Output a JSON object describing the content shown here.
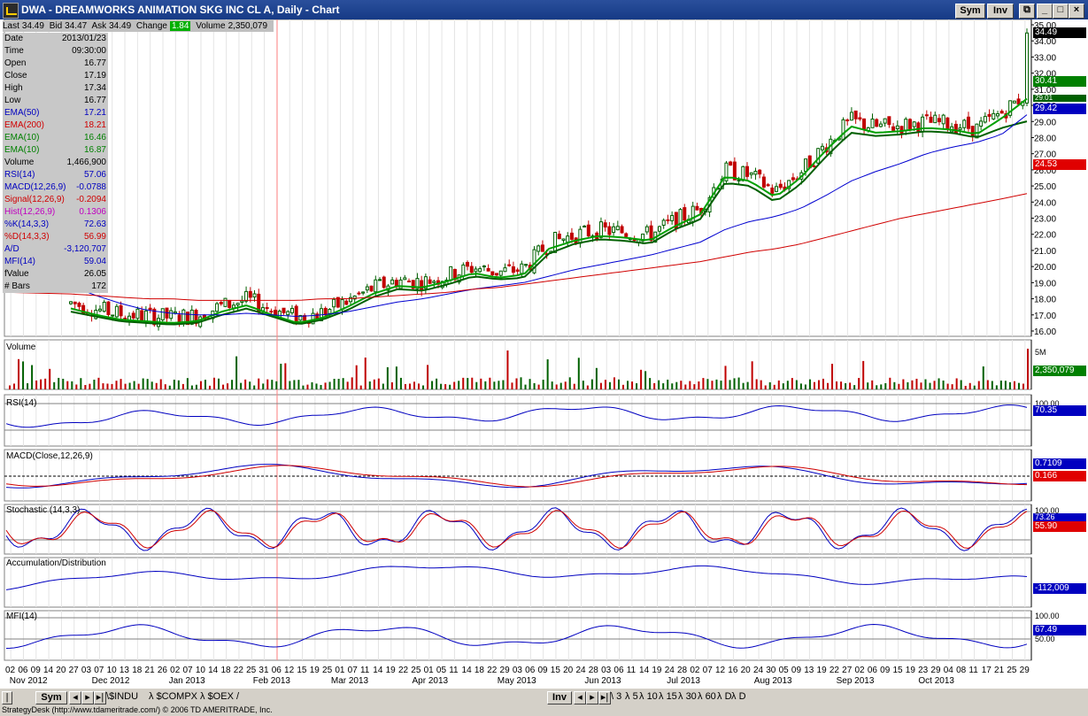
{
  "window": {
    "title": "DWA - DREAMWORKS ANIMATION SKG INC CL A, Daily - Chart",
    "sym_btn": "Sym",
    "inv_btn": "Inv",
    "restore_btn": "⧉",
    "minimize_btn": "_",
    "maximize_btn": "□",
    "close_btn": "×"
  },
  "quote": {
    "last_label": "Last",
    "last": "34.49",
    "bid_label": "Bid",
    "bid": "34.47",
    "ask_label": "Ask",
    "ask": "34.49",
    "change_label": "Change",
    "change": "1.84",
    "volume_label": "Volume",
    "volume": "2,350,079"
  },
  "data_window": [
    {
      "label": "Date",
      "value": "2013/01/23",
      "color": "#000000"
    },
    {
      "label": "Time",
      "value": "09:30:00",
      "color": "#000000"
    },
    {
      "label": "Open",
      "value": "16.77",
      "color": "#000000"
    },
    {
      "label": "Close",
      "value": "17.19",
      "color": "#000000"
    },
    {
      "label": "High",
      "value": "17.34",
      "color": "#000000"
    },
    {
      "label": "Low",
      "value": "16.77",
      "color": "#000000"
    },
    {
      "label": "EMA(50)",
      "value": "17.21",
      "color": "#0000c0"
    },
    {
      "label": "EMA(200)",
      "value": "18.21",
      "color": "#d00000"
    },
    {
      "label": "EMA(10)",
      "value": "16.46",
      "color": "#008000"
    },
    {
      "label": "EMA(10)",
      "value": "16.87",
      "color": "#008000"
    },
    {
      "label": "Volume",
      "value": "1,466,900",
      "color": "#000000"
    },
    {
      "label": "RSI(14)",
      "value": "57.06",
      "color": "#0000c0"
    },
    {
      "label": "MACD(12,26,9)",
      "value": "-0.0788",
      "color": "#0000c0"
    },
    {
      "label": "Signal(12,26,9)",
      "value": "-0.2094",
      "color": "#d00000"
    },
    {
      "label": "Hist(12,26,9)",
      "value": "0.1306",
      "color": "#c000c0"
    },
    {
      "label": "%K(14,3,3)",
      "value": "72.63",
      "color": "#0000c0"
    },
    {
      "label": "%D(14,3,3)",
      "value": "56.99",
      "color": "#d00000"
    },
    {
      "label": "A/D",
      "value": "-3,120,707",
      "color": "#0000c0"
    },
    {
      "label": "MFI(14)",
      "value": "59.04",
      "color": "#0000c0"
    },
    {
      "label": "fValue",
      "value": "26.05",
      "color": "#000000"
    },
    {
      "label": "# Bars",
      "value": "172",
      "color": "#000000"
    }
  ],
  "price_axis": {
    "ticks": [
      "35.00",
      "34.00",
      "33.00",
      "32.00",
      "31.00",
      "30.00",
      "29.00",
      "28.00",
      "27.00",
      "26.00",
      "25.00",
      "24.00",
      "23.00",
      "22.00",
      "21.00",
      "20.00",
      "19.00",
      "18.00",
      "17.00",
      "16.00"
    ],
    "last_tag": "34.49",
    "ema10_tag": "30.41",
    "ema10b_tag": "29.01",
    "ema50_tag": "29.42",
    "ema200_tag": "24.53"
  },
  "panels": {
    "volume": {
      "label": "Volume",
      "tick": "5M",
      "tag": "2,350,079"
    },
    "rsi": {
      "label": "RSI(14)",
      "tick": "100.00",
      "tag": "70.35"
    },
    "macd": {
      "label": "MACD(Close,12,26,9)",
      "tag1": "0.7109",
      "tag2": "0.166"
    },
    "stoch": {
      "label": "Stochastic (14,3,3)",
      "tick": "100.00",
      "tag1": "73.26",
      "tag2": "55.90"
    },
    "ad": {
      "label": "Accumulation/Distribution",
      "tag": "-112,009"
    },
    "mfi": {
      "label": "MFI(14)",
      "tick1": "100.00",
      "tick2": "50.00",
      "tag": "67.49"
    }
  },
  "date_axis": {
    "days": [
      "02",
      "06",
      "09",
      "14",
      "20",
      "27",
      "03",
      "07",
      "10",
      "13",
      "18",
      "21",
      "26",
      "02",
      "07",
      "10",
      "14",
      "18",
      "22",
      "25",
      "31",
      "06",
      "12",
      "15",
      "19",
      "25",
      "01",
      "07",
      "11",
      "14",
      "19",
      "22",
      "25",
      "01",
      "05",
      "11",
      "14",
      "18",
      "22",
      "29",
      "03",
      "06",
      "09",
      "15",
      "20",
      "24",
      "28",
      "03",
      "06",
      "11",
      "14",
      "19",
      "24",
      "28",
      "02",
      "07",
      "12",
      "16",
      "20",
      "24",
      "30",
      "05",
      "09",
      "13",
      "19",
      "22",
      "27",
      "02",
      "06",
      "09",
      "15",
      "19",
      "23",
      "29",
      "04",
      "08",
      "11",
      "17",
      "21",
      "25",
      "29"
    ],
    "months": [
      {
        "label": "Nov 2012",
        "pos": 0.005
      },
      {
        "label": "Dec 2012",
        "pos": 0.085
      },
      {
        "label": "Jan 2013",
        "pos": 0.16
      },
      {
        "label": "Feb 2013",
        "pos": 0.242
      },
      {
        "label": "Mar 2013",
        "pos": 0.318
      },
      {
        "label": "Apr 2013",
        "pos": 0.397
      },
      {
        "label": "May 2013",
        "pos": 0.48
      },
      {
        "label": "Jun 2013",
        "pos": 0.565
      },
      {
        "label": "Jul 2013",
        "pos": 0.645
      },
      {
        "label": "Aug 2013",
        "pos": 0.73
      },
      {
        "label": "Sep 2013",
        "pos": 0.81
      },
      {
        "label": "Oct 2013",
        "pos": 0.89
      }
    ]
  },
  "bottom_bar": {
    "sym_btn": "Sym",
    "tabs": [
      "$INDU",
      "$COMPX",
      "$OEX"
    ],
    "inv_btn": "Inv",
    "interval_tabs": [
      "3",
      "5",
      "10",
      "15",
      "30",
      "60",
      "D",
      "D"
    ]
  },
  "status": {
    "text": "StrategyDesk (http://www.tdameritrade.com/) © 2006 TD AMERITRADE, Inc."
  },
  "colors": {
    "ema10": "#00a000",
    "ema10b": "#006000",
    "ema50": "#0000d0",
    "ema200": "#d00000",
    "up": "#006000",
    "down": "#c00000",
    "tag_green": "#008000",
    "tag_blue": "#0000c0",
    "tag_red": "#e00000"
  },
  "chart_data": {
    "type": "line",
    "title": "DWA - DREAMWORKS ANIMATION SKG INC CL A, Daily",
    "xlabel": "",
    "ylabel": "",
    "ylim": [
      16,
      35
    ],
    "x_range": [
      "Nov 2012",
      "Oct 2013"
    ],
    "series": [
      {
        "name": "EMA(10)",
        "values": [
          17.4,
          17.0,
          16.7,
          16.6,
          16.5,
          16.6,
          17.2,
          17.6,
          17.0,
          16.5,
          16.8,
          17.5,
          18.3,
          18.8,
          18.7,
          19.1,
          19.6,
          19.3,
          19.5,
          21.1,
          21.6,
          21.9,
          21.8,
          21.6,
          22.5,
          23.2,
          25.6,
          25.3,
          24.3,
          25.5,
          27.2,
          28.7,
          28.3,
          28.4,
          28.6,
          28.5,
          28.2,
          29.2,
          30.41
        ]
      },
      {
        "name": "EMA(10)",
        "values": [
          17.2,
          16.9,
          16.6,
          16.5,
          16.4,
          16.5,
          17.0,
          17.4,
          16.9,
          16.4,
          16.7,
          17.3,
          18.1,
          18.6,
          18.5,
          18.9,
          19.4,
          19.2,
          19.3,
          20.8,
          21.4,
          21.7,
          21.6,
          21.4,
          22.3,
          22.9,
          25.2,
          25.0,
          24.0,
          25.1,
          26.8,
          28.3,
          28.1,
          28.2,
          28.4,
          28.3,
          28.0,
          28.6,
          29.01
        ]
      },
      {
        "name": "EMA(50)",
        "values": [
          18.8,
          18.2,
          17.7,
          17.3,
          17.1,
          17.0,
          17.0,
          17.1,
          17.0,
          16.9,
          17.0,
          17.2,
          17.5,
          17.8,
          18.0,
          18.3,
          18.6,
          18.8,
          19.0,
          19.4,
          19.8,
          20.1,
          20.4,
          20.7,
          21.1,
          21.5,
          22.3,
          22.8,
          23.1,
          23.6,
          24.4,
          25.3,
          25.9,
          26.4,
          27.0,
          27.4,
          27.7,
          28.2,
          29.42
        ]
      },
      {
        "name": "EMA(200)",
        "values": [
          18.3,
          18.2,
          18.1,
          18.0,
          18.0,
          17.9,
          17.9,
          17.9,
          17.9,
          17.9,
          18.0,
          18.0,
          18.1,
          18.2,
          18.3,
          18.4,
          18.6,
          18.7,
          18.9,
          19.1,
          19.3,
          19.5,
          19.7,
          19.9,
          20.1,
          20.3,
          20.6,
          20.9,
          21.1,
          21.4,
          21.8,
          22.2,
          22.6,
          23.0,
          23.3,
          23.6,
          23.9,
          24.2,
          24.53
        ]
      }
    ]
  }
}
